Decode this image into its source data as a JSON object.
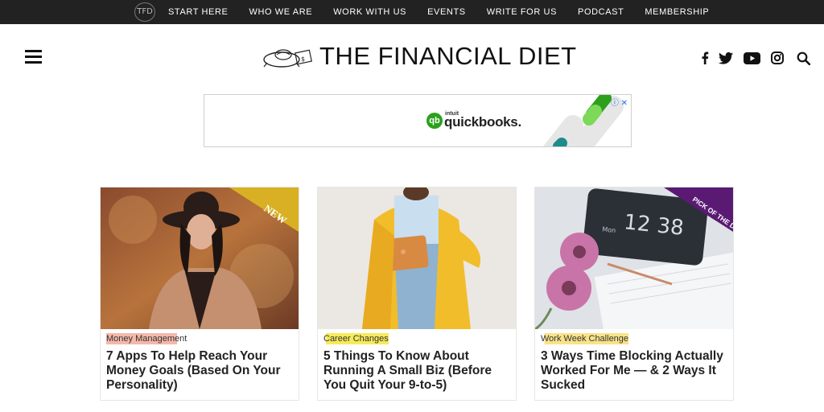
{
  "topbar": {
    "badge": "TFD",
    "nav": [
      "START HERE",
      "WHO WE ARE",
      "WORK WITH US",
      "EVENTS",
      "WRITE FOR US",
      "PODCAST",
      "MEMBERSHIP"
    ]
  },
  "header": {
    "logo_text": "THE FINANCIAL DIET",
    "icons": [
      "facebook-icon",
      "twitter-icon",
      "youtube-icon",
      "instagram-icon",
      "search-icon"
    ]
  },
  "ad": {
    "brand_small": "intuit",
    "brand": "quickbooks.",
    "qb_mark": "qb"
  },
  "cards": [
    {
      "badge": "NEW",
      "category": "Money Management",
      "title": "7 Apps To Help Reach Your Money Goals (Based On Your Personality)"
    },
    {
      "category": "Career Changes",
      "title": "5 Things To Know About Running A Small Biz (Before You Quit Your 9-to-5)"
    },
    {
      "badge": "PICK OF THE DAY",
      "clock": "12 38",
      "clock_sub": "Mon",
      "category": "Work Week Challenge",
      "title": "3 Ways Time Blocking Actually Worked For Me — & 2 Ways It Sucked"
    }
  ],
  "colors": {
    "topbar_bg": "#222222",
    "badge_new": "#d9b024",
    "badge_pick": "#5a1a73",
    "quickbooks_green": "#2ca01c"
  }
}
